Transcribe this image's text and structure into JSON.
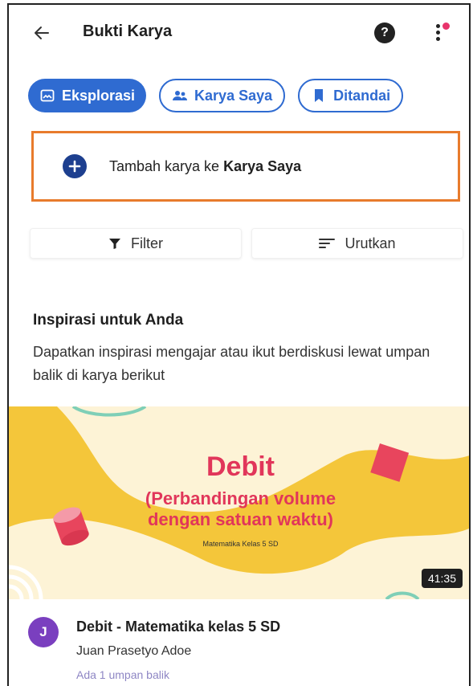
{
  "appbar": {
    "back_icon": "arrow-left-icon",
    "title": "Bukti Karya",
    "help_icon": "help-circle-icon",
    "help_glyph": "?",
    "more_icon": "more-vertical-icon",
    "notification_color": "#e8336b"
  },
  "tabs": [
    {
      "label": "Eksplorasi",
      "icon": "image-icon",
      "active": true
    },
    {
      "label": "Karya Saya",
      "icon": "people-icon",
      "active": false
    },
    {
      "label": "Ditandai",
      "icon": "bookmark-icon",
      "active": false
    }
  ],
  "add_card": {
    "prefix": "Tambah karya ke ",
    "bold": "Karya Saya",
    "icon": "plus-circle-icon"
  },
  "filter": {
    "label": "Filter",
    "icon": "filter-icon"
  },
  "sort": {
    "label": "Urutkan",
    "icon": "sort-icon"
  },
  "inspiration": {
    "title": "Inspirasi untuk Anda",
    "description": "Dapatkan inspirasi mengajar atau ikut berdiskusi lewat umpan balik di karya berikut"
  },
  "post": {
    "thumbnail": {
      "heading": "Debit",
      "subheading_line1": "(Perbandingan volume",
      "subheading_line2": "dengan satuan waktu)",
      "caption": "Matematika Kelas 5 SD",
      "duration": "41:35"
    },
    "avatar_initial": "J",
    "avatar_color": "#7a3fbf",
    "title": "Debit - Matematika kelas 5 SD",
    "author": "Juan Prasetyo Adoe",
    "feedback": "Ada 1 umpan balik"
  },
  "colors": {
    "primary": "#2f6bd1",
    "highlight_border": "#e87b2c",
    "thumbnail_bg": "#f4c63a",
    "thumbnail_text": "#e1365a"
  }
}
